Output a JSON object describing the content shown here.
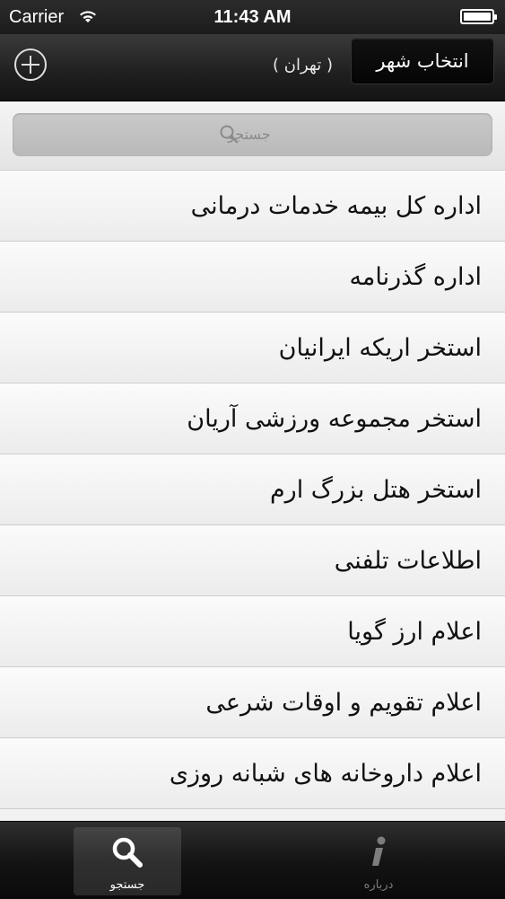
{
  "status_bar": {
    "carrier": "Carrier",
    "time": "11:43 AM"
  },
  "nav": {
    "city": "( تهران )",
    "select_city": "انتخاب شهر"
  },
  "search": {
    "placeholder": "جستجو"
  },
  "items": [
    "اداره کل بیمه خدمات درمانی",
    "اداره گذرنامه",
    "استخر اریکه ایرانیان",
    "استخر مجموعه ورزشی آریان",
    "استخر هتل بزرگ ارم",
    "اطلاعات تلفنی",
    "اعلام ارز گویا",
    "اعلام تقویم و اوقات شرعی",
    "اعلام داروخانه های شبانه روزی"
  ],
  "tabs": {
    "search": "جستجو",
    "about": "درباره"
  }
}
